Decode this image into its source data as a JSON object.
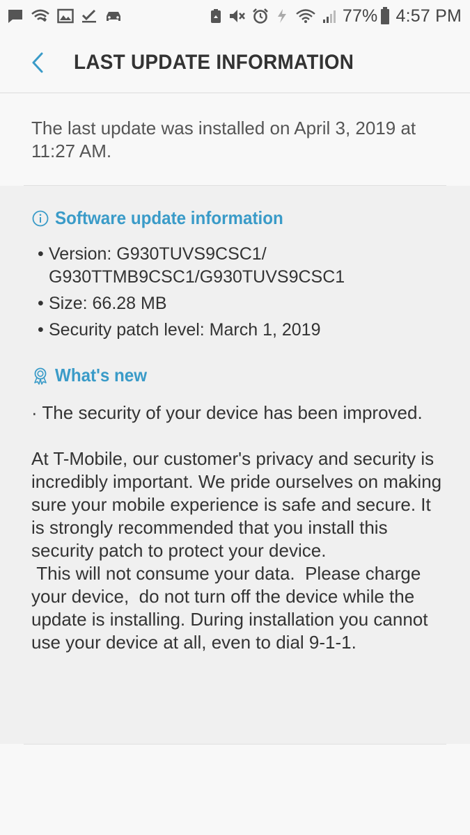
{
  "status_bar": {
    "left_icons": [
      "message-icon",
      "wifi-calling-icon",
      "gallery-icon",
      "check-icon",
      "car-mode-icon"
    ],
    "right_icons": [
      "recycle-icon",
      "mute-icon",
      "alarm-icon",
      "data-saver-icon",
      "wifi-icon",
      "signal-icon"
    ],
    "battery_percent": "77%",
    "time": "4:57 PM"
  },
  "header": {
    "title": "LAST UPDATE INFORMATION",
    "back_icon": "chevron-left-icon"
  },
  "last_update": {
    "text": "The last update was installed on April 3, 2019 at 11:27 AM."
  },
  "software_info": {
    "icon": "info-circle-icon",
    "title": "Software update information",
    "items": [
      {
        "bullet": "•",
        "text": "Version: G930TUVS9CSC1/ G930TTMB9CSC1/G930TUVS9CSC1"
      },
      {
        "bullet": "•",
        "text": "Size: 66.28 MB"
      },
      {
        "bullet": "•",
        "text": "Security patch level: March 1, 2019"
      }
    ]
  },
  "whats_new": {
    "icon": "badge-ribbon-icon",
    "title": "What's new",
    "paragraph_1": "· The security of your device has been improved.",
    "paragraph_2": "At T-Mobile, our customer's privacy and security is incredibly important. We pride ourselves on making sure your mobile experience is safe and secure. It is strongly recommended that you install this security patch to protect your device.\n This will not consume your data.  Please charge your device,  do not turn off the device while the update is installing. During installation you cannot use your device at all, even to dial 9-1-1."
  },
  "colors": {
    "accent": "#3a9bc8",
    "background": "#f8f8f8",
    "panel": "#f0f0f0",
    "text": "#333333"
  }
}
